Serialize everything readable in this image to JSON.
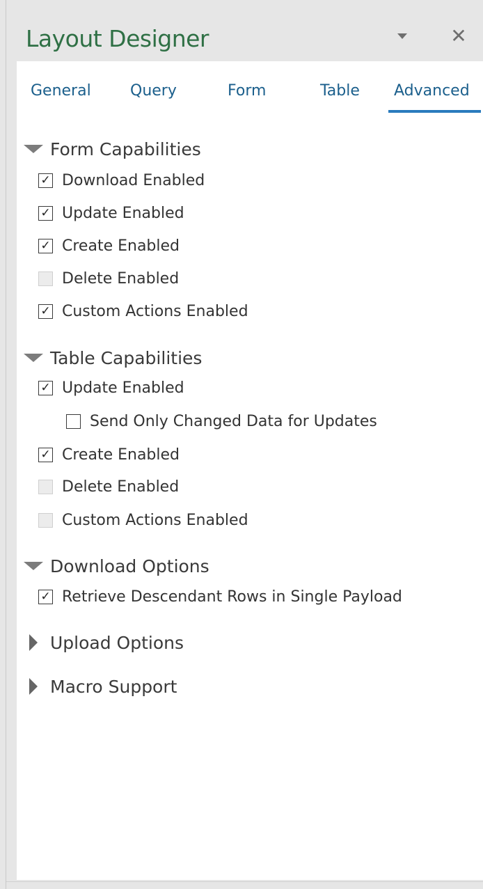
{
  "window": {
    "title": "Layout Designer",
    "dropdown_icon": "caret-down-icon",
    "close_glyph": "✕"
  },
  "tabs": [
    {
      "label": "General",
      "active": false
    },
    {
      "label": "Query",
      "active": false
    },
    {
      "label": "Form",
      "active": false
    },
    {
      "label": "Table",
      "active": false
    },
    {
      "label": "Advanced",
      "active": true
    }
  ],
  "sections": {
    "form": {
      "label": "Form Capabilities",
      "expanded": true,
      "items": [
        {
          "label": "Download Enabled",
          "checked": true,
          "enabled": true
        },
        {
          "label": "Update Enabled",
          "checked": true,
          "enabled": true
        },
        {
          "label": "Create Enabled",
          "checked": true,
          "enabled": true
        },
        {
          "label": "Delete Enabled",
          "checked": false,
          "enabled": false
        },
        {
          "label": "Custom Actions Enabled",
          "checked": true,
          "enabled": true
        }
      ]
    },
    "table": {
      "label": "Table Capabilities",
      "expanded": true,
      "items": [
        {
          "label": "Update Enabled",
          "checked": true,
          "enabled": true
        },
        {
          "label": "Send Only Changed Data for Updates",
          "checked": false,
          "enabled": true
        },
        {
          "label": "Create Enabled",
          "checked": true,
          "enabled": true
        },
        {
          "label": "Delete Enabled",
          "checked": false,
          "enabled": false
        },
        {
          "label": "Custom Actions Enabled",
          "checked": false,
          "enabled": false
        }
      ]
    },
    "download": {
      "label": "Download Options",
      "expanded": true,
      "items": [
        {
          "label": "Retrieve Descendant Rows in Single Payload",
          "checked": true,
          "enabled": true
        }
      ]
    },
    "upload": {
      "label": "Upload Options",
      "expanded": false
    },
    "macro": {
      "label": "Macro Support",
      "expanded": false
    }
  },
  "colors": {
    "title": "#2f7045",
    "tab_text": "#1b5f8c",
    "tab_active_underline": "#2a7bbd",
    "panel_bg": "#e6e6e6",
    "content_bg": "#ffffff"
  }
}
